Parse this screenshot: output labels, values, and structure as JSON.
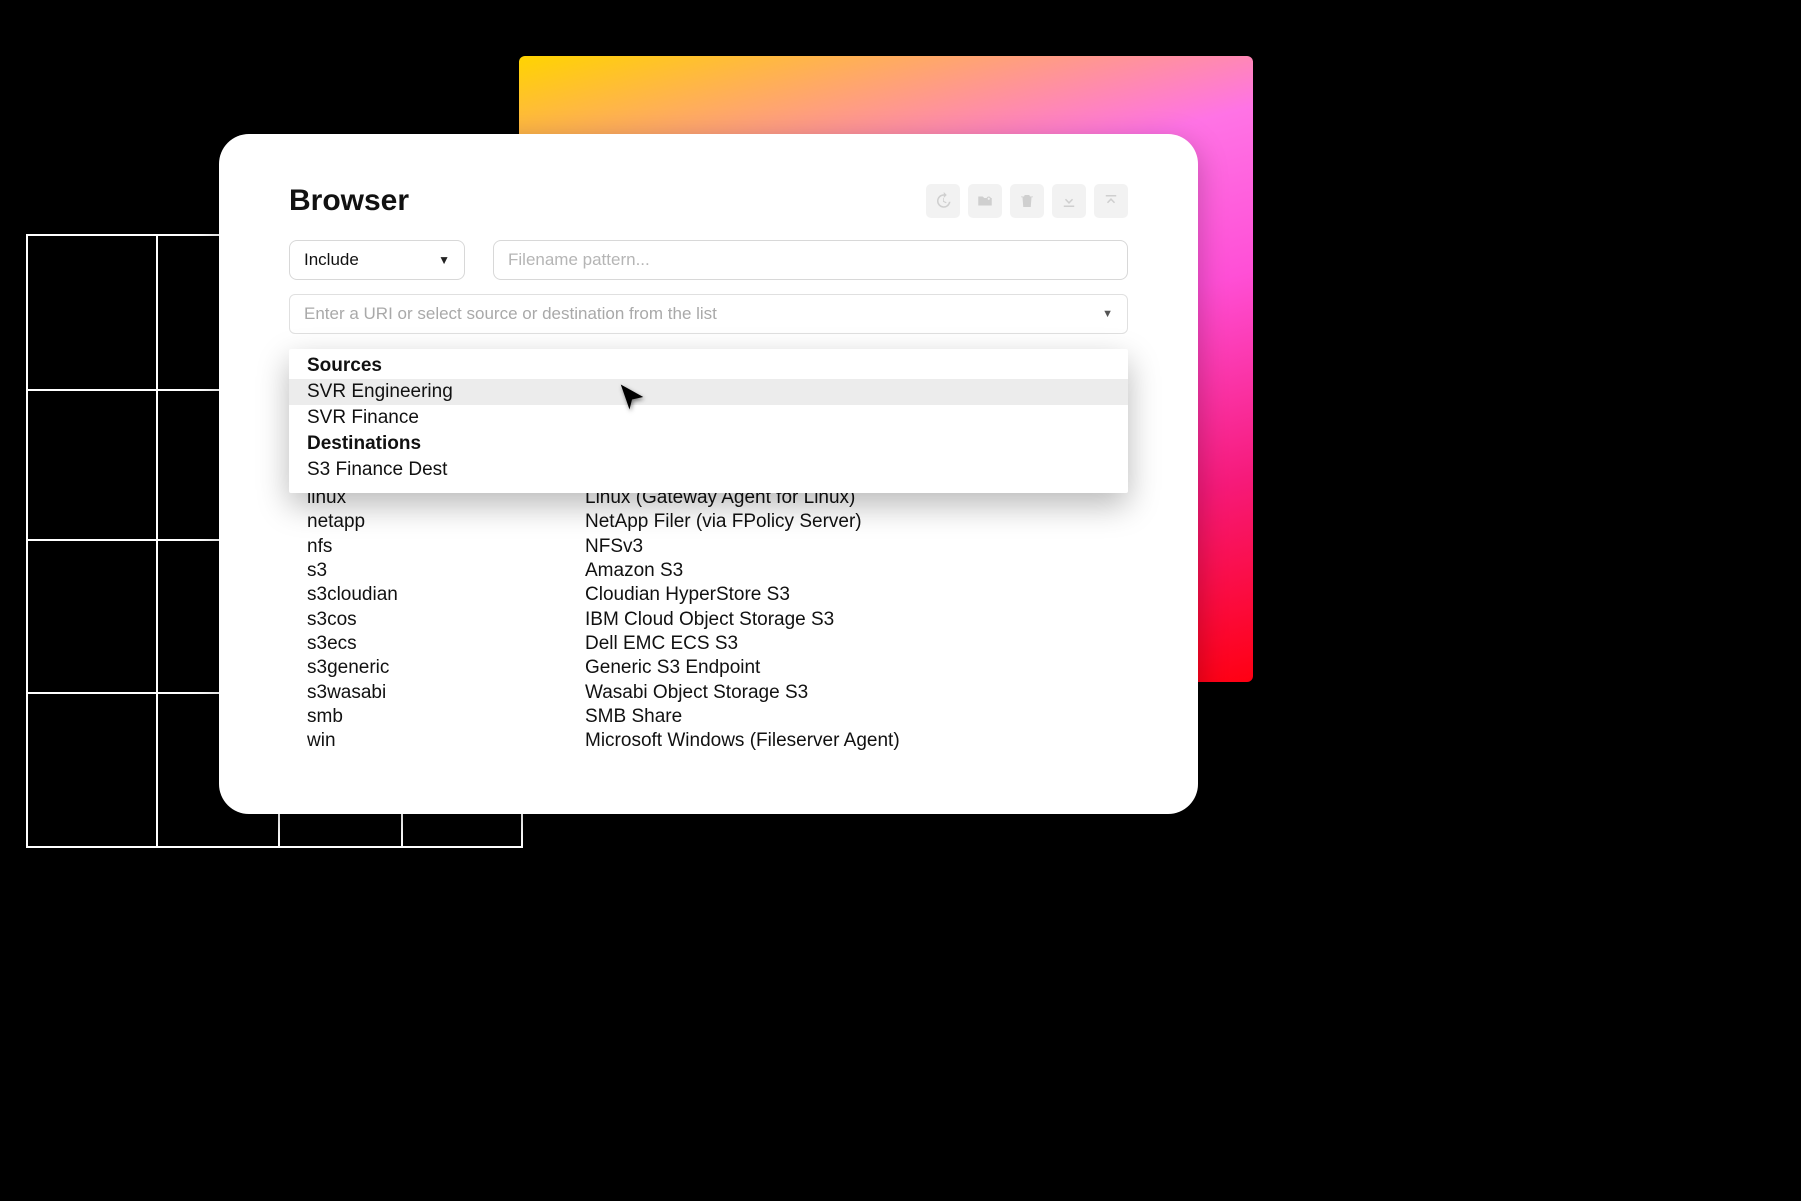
{
  "panel": {
    "title": "Browser"
  },
  "toolbar": {
    "icons": [
      "history-icon",
      "folder-settings-icon",
      "trash-icon",
      "download-icon",
      "upload-icon"
    ]
  },
  "filter": {
    "include_label": "Include",
    "pattern_placeholder": "Filename pattern..."
  },
  "uri": {
    "placeholder": "Enter a URI or select source or destination from the list"
  },
  "dropdown": {
    "sources_heading": "Sources",
    "sources": [
      "SVR Engineering",
      "SVR Finance"
    ],
    "destinations_heading": "Destinations",
    "destinations": [
      "S3 Finance Dest"
    ]
  },
  "types": [
    {
      "key": "linux",
      "desc": "Linux (Gateway Agent for Linux)"
    },
    {
      "key": "netapp",
      "desc": "NetApp Filer (via FPolicy Server)"
    },
    {
      "key": "nfs",
      "desc": "NFSv3"
    },
    {
      "key": "s3",
      "desc": "Amazon S3"
    },
    {
      "key": "s3cloudian",
      "desc": "Cloudian HyperStore S3"
    },
    {
      "key": "s3cos",
      "desc": "IBM Cloud Object Storage S3"
    },
    {
      "key": "s3ecs",
      "desc": "Dell EMC ECS S3"
    },
    {
      "key": "s3generic",
      "desc": "Generic S3 Endpoint"
    },
    {
      "key": "s3wasabi",
      "desc": "Wasabi Object Storage S3"
    },
    {
      "key": "smb",
      "desc": "SMB Share"
    },
    {
      "key": "win",
      "desc": "Microsoft Windows (Fileserver Agent)"
    }
  ]
}
